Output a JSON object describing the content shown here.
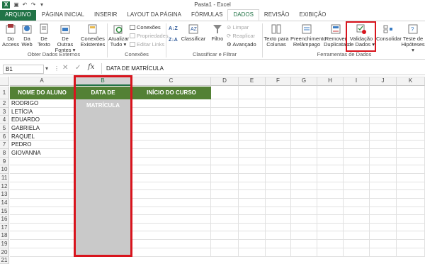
{
  "window": {
    "title": "Pasta1 - Excel"
  },
  "tabs": [
    "ARQUIVO",
    "PÁGINA INICIAL",
    "INSERIR",
    "LAYOUT DA PÁGINA",
    "FÓRMULAS",
    "DADOS",
    "REVISÃO",
    "EXIBIÇÃO"
  ],
  "active_tab": "DADOS",
  "ribbon": {
    "groups": {
      "external": "Obter Dados Externos",
      "connections": "Conexões",
      "sortfilter": "Classificar e Filtrar",
      "datatools": "Ferramentas de Dados"
    },
    "buttons": {
      "access": [
        "Do",
        "Access"
      ],
      "web": [
        "Da",
        "Web"
      ],
      "text": [
        "De",
        "Texto"
      ],
      "other": [
        "De Outras",
        "Fontes ▾"
      ],
      "existing": [
        "Conexões",
        "Existentes"
      ],
      "refresh": [
        "Atualizar",
        "Tudo ▾"
      ],
      "conn_small": "Conexões",
      "props_small": "Propriedades",
      "edit_links_small": "Editar Links",
      "sort_az": "",
      "classify": "Classificar",
      "filter": "Filtro",
      "clear": "Limpar",
      "reapply": "Reaplicar",
      "advanced": "Avançado",
      "text_cols": [
        "Texto para",
        "Colunas"
      ],
      "flash_fill": [
        "Preenchimento",
        "Relâmpago"
      ],
      "remove_dup": [
        "Remover",
        "Duplicatas"
      ],
      "validation": [
        "Validação",
        "de Dados ▾"
      ],
      "consolidate": "Consolidar",
      "whatif": [
        "Teste de",
        "Hipóteses ▾"
      ]
    }
  },
  "formula_bar": {
    "name_box": "B1",
    "fx": "fx",
    "content": "DATA DE MATRÍCULA"
  },
  "columns": [
    "A",
    "B",
    "C",
    "D",
    "E",
    "F",
    "G",
    "H",
    "I",
    "J",
    "K"
  ],
  "rows": [
    "1",
    "2",
    "3",
    "4",
    "5",
    "6",
    "7",
    "8",
    "9",
    "10",
    "11",
    "12",
    "13",
    "14",
    "15",
    "16",
    "17",
    "18",
    "19",
    "20",
    "21"
  ],
  "table": {
    "headers": [
      "NOME DO ALUNO",
      "DATA DE MATRÍCULA",
      "INÍCIO DO CURSO"
    ],
    "names": [
      "RODRIGO",
      "LETÍCIA",
      "EDUARDO",
      "GABRIELA",
      "RAQUEL",
      "PEDRO",
      "GIOVANNA"
    ]
  },
  "colors": {
    "excel_green": "#217346",
    "header_fill": "#538135",
    "highlight_red": "#d8141d",
    "selection_grey": "#c9c9c9"
  }
}
